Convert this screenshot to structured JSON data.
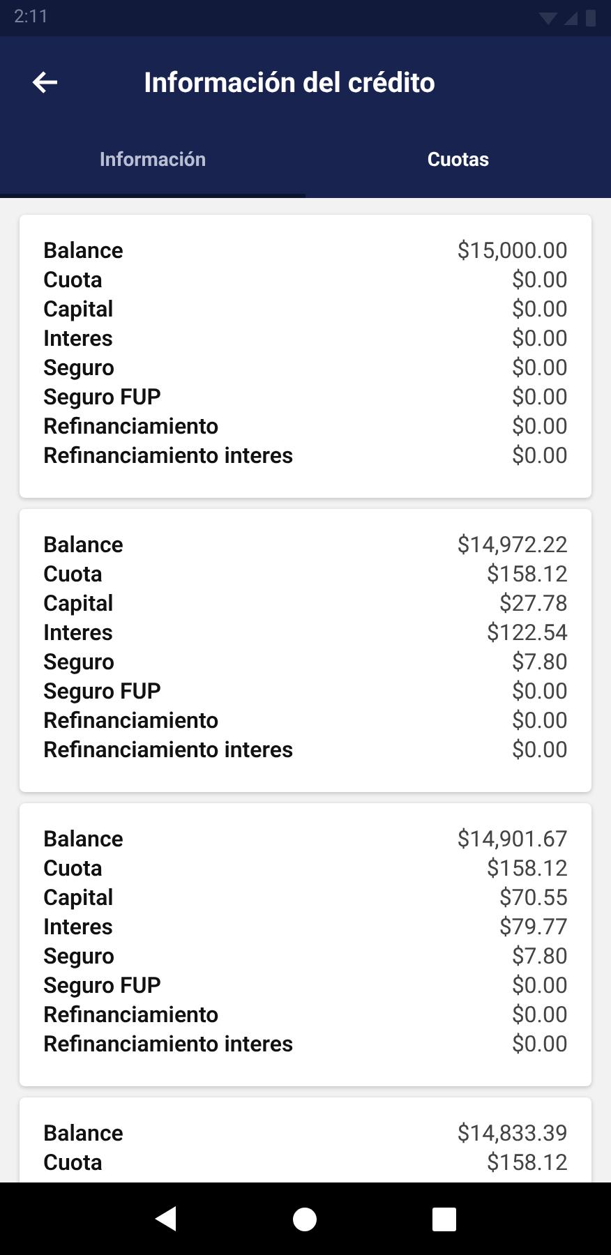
{
  "status_bar": {
    "time": "2:11"
  },
  "header": {
    "title": "Información del crédito"
  },
  "tabs": [
    {
      "label": "Información",
      "selected": false,
      "underlined": true
    },
    {
      "label": "Cuotas",
      "selected": true,
      "underlined": false
    }
  ],
  "cards": [
    {
      "rows": [
        {
          "label": "Balance",
          "value": "$15,000.00"
        },
        {
          "label": "Cuota",
          "value": "$0.00"
        },
        {
          "label": "Capital",
          "value": "$0.00"
        },
        {
          "label": "Interes",
          "value": "$0.00"
        },
        {
          "label": "Seguro",
          "value": "$0.00"
        },
        {
          "label": "Seguro FUP",
          "value": "$0.00"
        },
        {
          "label": "Refinanciamiento",
          "value": "$0.00"
        },
        {
          "label": "Refinanciamiento interes",
          "value": "$0.00"
        }
      ]
    },
    {
      "rows": [
        {
          "label": "Balance",
          "value": "$14,972.22"
        },
        {
          "label": "Cuota",
          "value": "$158.12"
        },
        {
          "label": "Capital",
          "value": "$27.78"
        },
        {
          "label": "Interes",
          "value": "$122.54"
        },
        {
          "label": "Seguro",
          "value": "$7.80"
        },
        {
          "label": "Seguro FUP",
          "value": "$0.00"
        },
        {
          "label": "Refinanciamiento",
          "value": "$0.00"
        },
        {
          "label": "Refinanciamiento interes",
          "value": "$0.00"
        }
      ]
    },
    {
      "rows": [
        {
          "label": "Balance",
          "value": "$14,901.67"
        },
        {
          "label": "Cuota",
          "value": "$158.12"
        },
        {
          "label": "Capital",
          "value": "$70.55"
        },
        {
          "label": "Interes",
          "value": "$79.77"
        },
        {
          "label": "Seguro",
          "value": "$7.80"
        },
        {
          "label": "Seguro FUP",
          "value": "$0.00"
        },
        {
          "label": "Refinanciamiento",
          "value": "$0.00"
        },
        {
          "label": "Refinanciamiento interes",
          "value": "$0.00"
        }
      ]
    },
    {
      "rows": [
        {
          "label": "Balance",
          "value": "$14,833.39"
        },
        {
          "label": "Cuota",
          "value": "$158.12"
        }
      ]
    }
  ]
}
